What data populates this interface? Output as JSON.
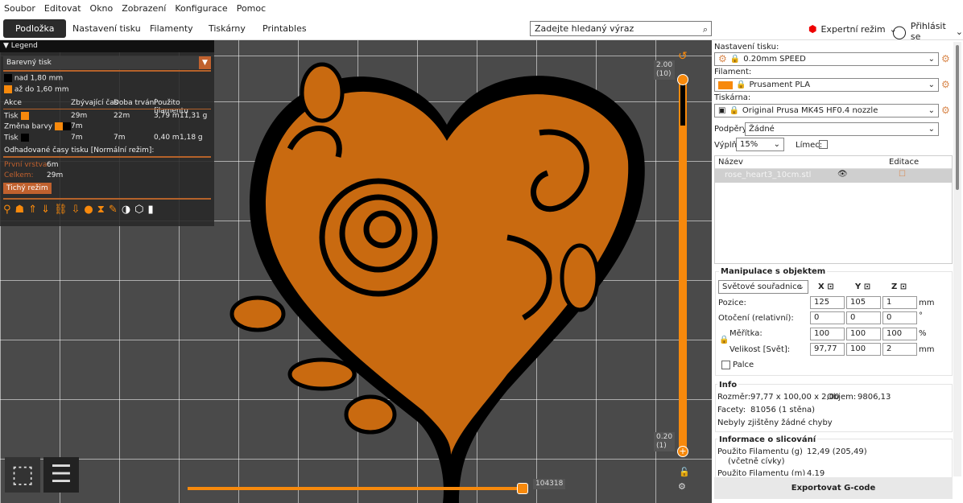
{
  "menu": [
    "Soubor",
    "Editovat",
    "Okno",
    "Zobrazení",
    "Konfigurace",
    "Pomoc"
  ],
  "tabs": [
    "Podložka",
    "Nastavení tisku",
    "Filamenty",
    "Tiskárny",
    "Printables"
  ],
  "search": {
    "placeholder": "Zadejte hledaný výraz"
  },
  "mode": "Expertní režim",
  "login": "Přihlásit se",
  "legend": {
    "title": "Legend",
    "view_type": "Barevný tisk",
    "ranges": [
      {
        "label": "nad 1,80 mm",
        "color": "#000000"
      },
      {
        "label": "až do 1,60 mm",
        "color": "#f7890c"
      }
    ],
    "columns": [
      "Akce",
      "Zbývající čas",
      "Doba trvání",
      "Použito filamentu"
    ],
    "rows": [
      {
        "action": "Tisk",
        "remaining": "29m",
        "duration": "22m",
        "length": "3,79 m",
        "weight": "11,31 g"
      },
      {
        "action": "Změna barvy",
        "remaining": "7m",
        "duration": "",
        "length": "",
        "weight": ""
      },
      {
        "action": "Tisk",
        "remaining": "7m",
        "duration": "7m",
        "length": "0,40 m",
        "weight": "1,18 g"
      }
    ],
    "estimated": "Odhadované časy tisku [Normální režim]:",
    "first_layer_label": "První vrstva:",
    "first_layer": "6m",
    "total_label": "Celkem:",
    "total": "29m",
    "silent_button": "Tichý režim"
  },
  "slider": {
    "top_value": "2.00",
    "top_layer": "(10)",
    "bottom_value": "0.20",
    "bottom_layer": "(1)",
    "horizontal_value": "104318"
  },
  "right": {
    "print_settings_label": "Nastavení tisku:",
    "print_settings": "0.20mm SPEED",
    "filament_label": "Filament:",
    "filament": "Prusament PLA",
    "filament_color": "#f7890c",
    "printer_label": "Tiskárna:",
    "printer": "Original Prusa MK4S HF0.4 nozzle",
    "supports_label": "Podpěry:",
    "supports": "Žádné",
    "infill_label": "Výplň:",
    "infill": "15%",
    "brim_label": "Límec:",
    "list_name": "Název",
    "list_edit": "Editace",
    "object": "rose_heart3_10cm.stl",
    "manip": {
      "title": "Manipulace s objektem",
      "coords": "Světové souřadnice",
      "x": "X",
      "y": "Y",
      "z": "Z",
      "position_label": "Pozice:",
      "position": [
        "125",
        "105",
        "1"
      ],
      "position_unit": "mm",
      "rotation_label": "Otočení (relativní):",
      "rotation": [
        "0",
        "0",
        "0"
      ],
      "rotation_unit": "°",
      "scale_label": "Měřítka:",
      "scale": [
        "100",
        "100",
        "100"
      ],
      "scale_unit": "%",
      "size_label": "Velikost [Svět]:",
      "size": [
        "97,77",
        "100",
        "2"
      ],
      "size_unit": "mm",
      "inches": "Palce"
    },
    "info": {
      "title": "Info",
      "size_label": "Rozměr:",
      "size": "97,77 x 100,00 x 2,00",
      "volume_label": "Objem:",
      "volume": "9806,13",
      "facets_label": "Facety:",
      "facets": "81056 (1 stěna)",
      "errors": "Nebyly zjištěny žádné chyby"
    },
    "slice": {
      "title": "Informace o slicování",
      "used_g_label": "Použito Filamentu (g)",
      "used_g_sub": "(včetně cívky)",
      "used_g": "12,49 (205,49)",
      "used_m_label": "Použito Filamentu (m)",
      "used_m": "4,19"
    },
    "export": "Exportovat G-code"
  }
}
